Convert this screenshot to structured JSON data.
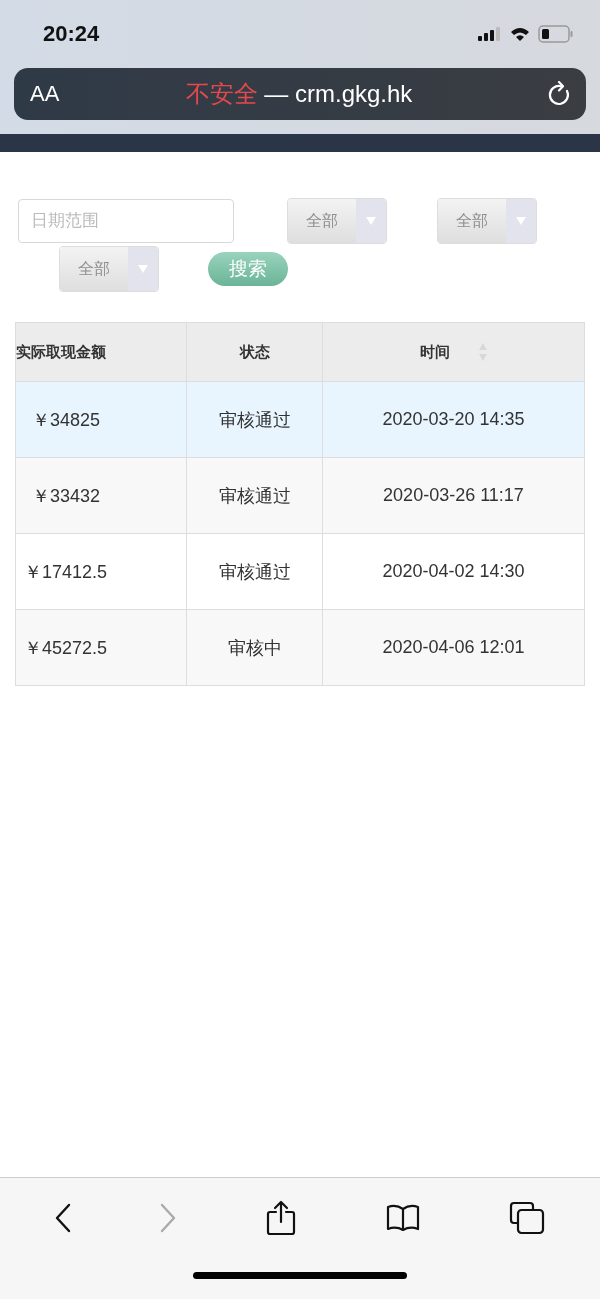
{
  "status_bar": {
    "time": "20:24"
  },
  "address_bar": {
    "text_size": "AA",
    "security": "不安全",
    "separator": "—",
    "domain": "crm.gkg.hk"
  },
  "filters": {
    "date_range": {
      "placeholder": "日期范围"
    },
    "selects": [
      {
        "value": "全部"
      },
      {
        "value": "全部"
      },
      {
        "value": "全部"
      }
    ],
    "search_button": "搜索"
  },
  "table": {
    "columns": [
      {
        "label": "实际取现金额",
        "sortable": false
      },
      {
        "label": "状态",
        "sortable": false
      },
      {
        "label": "时间",
        "sortable": true
      }
    ],
    "rows": [
      {
        "amount": "￥34825",
        "status": "审核通过",
        "time": "2020-03-20 14:35",
        "selected": true
      },
      {
        "amount": "￥33432",
        "status": "审核通过",
        "time": "2020-03-26 11:17",
        "selected": false
      },
      {
        "amount": "￥17412.5",
        "status": "审核通过",
        "time": "2020-04-02 14:30",
        "selected": false
      },
      {
        "amount": "￥45272.5",
        "status": "审核中",
        "time": "2020-04-06 12:01",
        "selected": false
      }
    ]
  },
  "toolbar": {
    "back_disabled": false,
    "forward_disabled": true
  }
}
